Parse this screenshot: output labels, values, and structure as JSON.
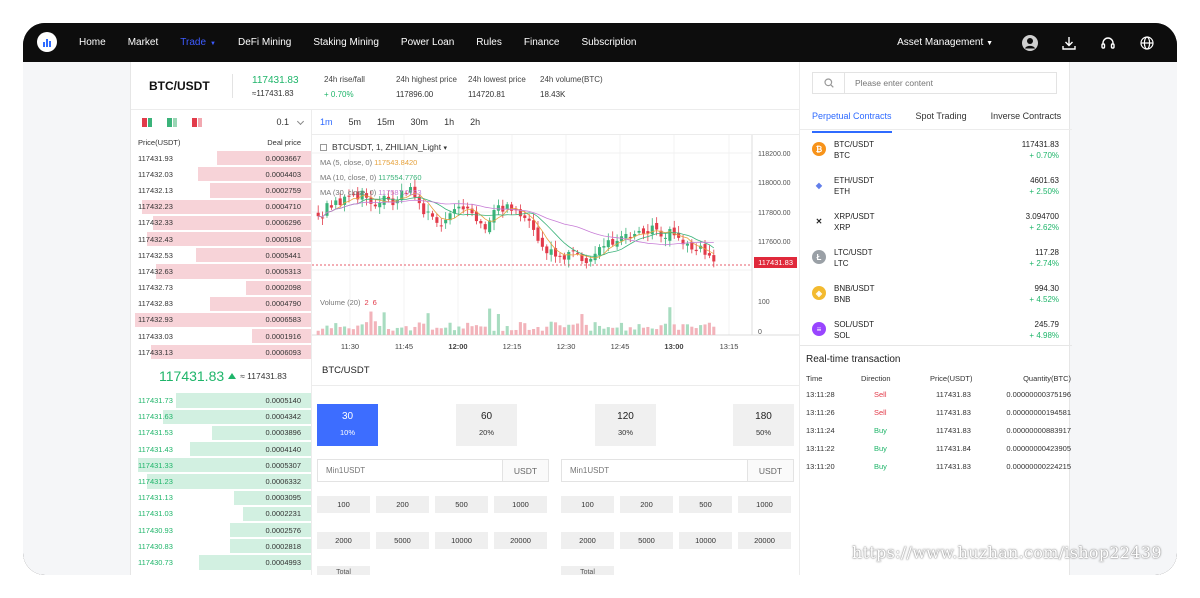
{
  "nav": {
    "items": [
      "Home",
      "Market",
      "Trade",
      "DeFi Mining",
      "Staking Mining",
      "Power Loan",
      "Rules",
      "Finance",
      "Subscription"
    ],
    "active": "Trade",
    "asset_management": "Asset Management"
  },
  "ticker": {
    "pair": "BTC/USDT",
    "price": "117431.83",
    "price_sub": "≈117431.83",
    "stats": [
      {
        "label": "24h rise/fall",
        "value": "+ 0.70%"
      },
      {
        "label": "24h highest price",
        "value": "117896.00"
      },
      {
        "label": "24h lowest price",
        "value": "114720.81"
      },
      {
        "label": "24h volume(BTC)",
        "value": "18.43K"
      }
    ]
  },
  "orderbook": {
    "precision": "0.1",
    "header": {
      "price": "Price(USDT)",
      "deal": "Deal price"
    },
    "asks": [
      {
        "price": "117431.93",
        "qty": "0.0003667",
        "depth": 0.52
      },
      {
        "price": "117432.03",
        "qty": "0.0004403",
        "depth": 0.63
      },
      {
        "price": "117432.13",
        "qty": "0.0002759",
        "depth": 0.56
      },
      {
        "price": "117432.23",
        "qty": "0.0004710",
        "depth": 0.94
      },
      {
        "price": "117432.33",
        "qty": "0.0006296",
        "depth": 0.88
      },
      {
        "price": "117432.43",
        "qty": "0.0005108",
        "depth": 0.91
      },
      {
        "price": "117432.53",
        "qty": "0.0005441",
        "depth": 0.64
      },
      {
        "price": "117432.63",
        "qty": "0.0005313",
        "depth": 0.86
      },
      {
        "price": "117432.73",
        "qty": "0.0002098",
        "depth": 0.36
      },
      {
        "price": "117432.83",
        "qty": "0.0004790",
        "depth": 0.56
      },
      {
        "price": "117432.93",
        "qty": "0.0006583",
        "depth": 0.98
      },
      {
        "price": "117433.03",
        "qty": "0.0001916",
        "depth": 0.33
      },
      {
        "price": "117433.13",
        "qty": "0.0006093",
        "depth": 0.89
      }
    ],
    "last_price": "117431.83",
    "last_price_sub": "≈ 117431.83",
    "bids": [
      {
        "price": "117431.73",
        "qty": "0.0005140",
        "depth": 0.75
      },
      {
        "price": "117431.63",
        "qty": "0.0004342",
        "depth": 0.82
      },
      {
        "price": "117431.53",
        "qty": "0.0003896",
        "depth": 0.55
      },
      {
        "price": "117431.43",
        "qty": "0.0004140",
        "depth": 0.67
      },
      {
        "price": "117431.33",
        "qty": "0.0005307",
        "depth": 0.96
      },
      {
        "price": "117431.23",
        "qty": "0.0006332",
        "depth": 0.91
      },
      {
        "price": "117431.13",
        "qty": "0.0003095",
        "depth": 0.43
      },
      {
        "price": "117431.03",
        "qty": "0.0002231",
        "depth": 0.38
      },
      {
        "price": "117430.93",
        "qty": "0.0002576",
        "depth": 0.45
      },
      {
        "price": "117430.83",
        "qty": "0.0002818",
        "depth": 0.45
      },
      {
        "price": "117430.73",
        "qty": "0.0004993",
        "depth": 0.62
      }
    ]
  },
  "chart": {
    "intervals": [
      "1m",
      "5m",
      "15m",
      "30m",
      "1h",
      "2h"
    ],
    "active_interval": "1m",
    "symbol": "BTCUSDT, 1, ZHILIAN_Light",
    "ma": [
      {
        "label": "MA (5, close, 0)",
        "value": "117543.8420",
        "color": "#e6a23c"
      },
      {
        "label": "MA (10, close, 0)",
        "value": "117554.7760",
        "color": "#3bb37a"
      },
      {
        "label": "MA (30, close, 0)",
        "value": "117587.0193",
        "color": "#c77dd6"
      }
    ],
    "price_ticks": [
      "118200.00",
      "118000.00",
      "117800.00",
      "117600.00"
    ],
    "last_tag": "117431.83",
    "volume_label": "Volume (20)",
    "volume_values": [
      "2",
      "6"
    ],
    "vol_ticks": [
      "100",
      "0"
    ],
    "time_ticks": [
      "11:30",
      "11:45",
      "12:00",
      "12:15",
      "12:30",
      "12:45",
      "13:00",
      "13:15"
    ],
    "up_color": "#3bb37a",
    "down_color": "#e23b4a"
  },
  "trade": {
    "title": "BTC/USDT",
    "leverage": [
      {
        "value": "30",
        "pct": "10%"
      },
      {
        "value": "60",
        "pct": "20%"
      },
      {
        "value": "120",
        "pct": "30%"
      },
      {
        "value": "180",
        "pct": "50%"
      }
    ],
    "amount_placeholder": "Min1USDT",
    "unit": "USDT",
    "quick_amounts": [
      "100",
      "200",
      "500",
      "1000",
      "2000",
      "5000",
      "10000",
      "20000"
    ],
    "total_label": "Total"
  },
  "right": {
    "search_placeholder": "Please enter content",
    "tabs": [
      "Perpetual Contracts",
      "Spot Trading",
      "Inverse Contracts"
    ],
    "active_tab": "Perpetual Contracts",
    "coins": [
      {
        "pair": "BTC/USDT",
        "sym": "BTC",
        "price": "117431.83",
        "change": "+ 0.70%",
        "icon": "bitcoin-icon",
        "color": "#f7931a",
        "glyph": "₿"
      },
      {
        "pair": "ETH/USDT",
        "sym": "ETH",
        "price": "4601.63",
        "change": "+ 2.50%",
        "icon": "ethereum-icon",
        "color": "#627eea",
        "glyph": "◆"
      },
      {
        "pair": "XRP/USDT",
        "sym": "XRP",
        "price": "3.094700",
        "change": "+ 2.62%",
        "icon": "xrp-icon",
        "color": "#222222",
        "glyph": "✕"
      },
      {
        "pair": "LTC/USDT",
        "sym": "LTC",
        "price": "117.28",
        "change": "+ 2.74%",
        "icon": "litecoin-icon",
        "color": "#9aa0a6",
        "glyph": "Ł"
      },
      {
        "pair": "BNB/USDT",
        "sym": "BNB",
        "price": "994.30",
        "change": "+ 4.52%",
        "icon": "bnb-icon",
        "color": "#f3ba2f",
        "glyph": "◈"
      },
      {
        "pair": "SOL/USDT",
        "sym": "SOL",
        "price": "245.79",
        "change": "+ 4.98%",
        "icon": "solana-icon",
        "color": "#9945ff",
        "glyph": "≡"
      }
    ],
    "realtime_title": "Real-time transaction",
    "realtime_headers": [
      "Time",
      "Direction",
      "Price(USDT)",
      "Quantity(BTC)"
    ],
    "realtime": [
      {
        "time": "13:11:28",
        "dir": "Sell",
        "price": "117431.83",
        "qty": "0.00000000375196"
      },
      {
        "time": "13:11:26",
        "dir": "Sell",
        "price": "117431.83",
        "qty": "0.00000000194581"
      },
      {
        "time": "13:11:24",
        "dir": "Buy",
        "price": "117431.83",
        "qty": "0.00000000883917"
      },
      {
        "time": "13:11:22",
        "dir": "Buy",
        "price": "117431.84",
        "qty": "0.00000000423905"
      },
      {
        "time": "13:11:20",
        "dir": "Buy",
        "price": "117431.83",
        "qty": "0.00000000224215"
      }
    ]
  },
  "watermark": "https://www.huzhan.com/ishop22439"
}
